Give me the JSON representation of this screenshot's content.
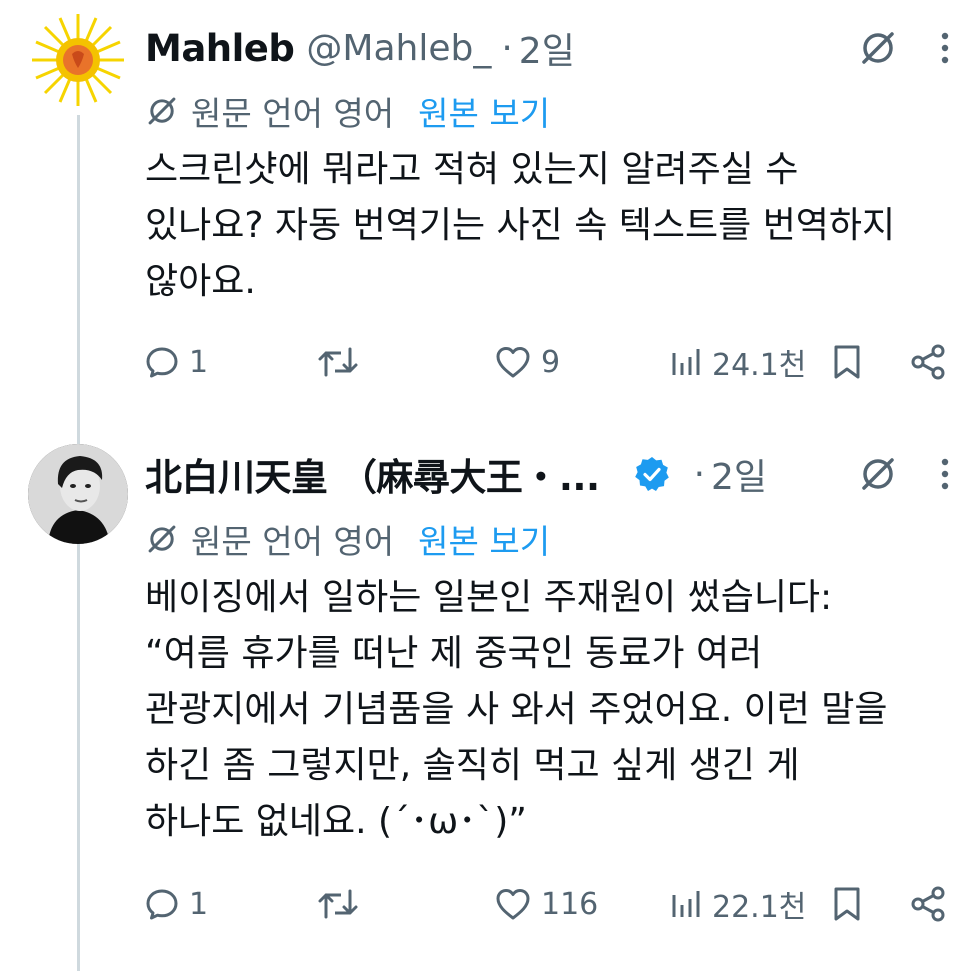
{
  "tweets": [
    {
      "name": "Mahleb",
      "handle": "@Mahleb_",
      "dot": "·",
      "time": "2일",
      "translation": {
        "lang_label": "원문 언어 영어",
        "show_original": "원본 보기"
      },
      "text": "스크린샷에 뭐라고 적혀 있는지 알려주실 수\n있나요? 자동 번역기는 사진 속 텍스트를 번역하지\n않아요.",
      "stats": {
        "replies": "1",
        "retweets": "",
        "likes": "9",
        "views": "24.1천"
      }
    },
    {
      "name": "北白川天皇 （麻尋大王・...",
      "verified": true,
      "dot": "·",
      "time": "2일",
      "translation": {
        "lang_label": "원문 언어 영어",
        "show_original": "원본 보기"
      },
      "text": "베이징에서 일하는 일본인 주재원이 썼습니다:\n“여름 휴가를 떠난 제 중국인 동료가 여러\n관광지에서 기념품을 사 와서 주었어요. 이런 말을\n하긴 좀 그렇지만, 솔직히 먹고 싶게 생긴 게\n하나도 없네요. (´･ω･`)”",
      "stats": {
        "replies": "1",
        "retweets": "",
        "likes": "116",
        "views": "22.1천"
      }
    }
  ],
  "colors": {
    "text": "#0f1419",
    "muted": "#536471",
    "accent": "#1d9bf0",
    "thread_line": "#cfd9de"
  },
  "icons": [
    "grok-icon",
    "more-icon",
    "translate-icon",
    "reply-icon",
    "retweet-icon",
    "like-icon",
    "views-icon",
    "bookmark-icon",
    "share-icon",
    "verified-icon"
  ]
}
